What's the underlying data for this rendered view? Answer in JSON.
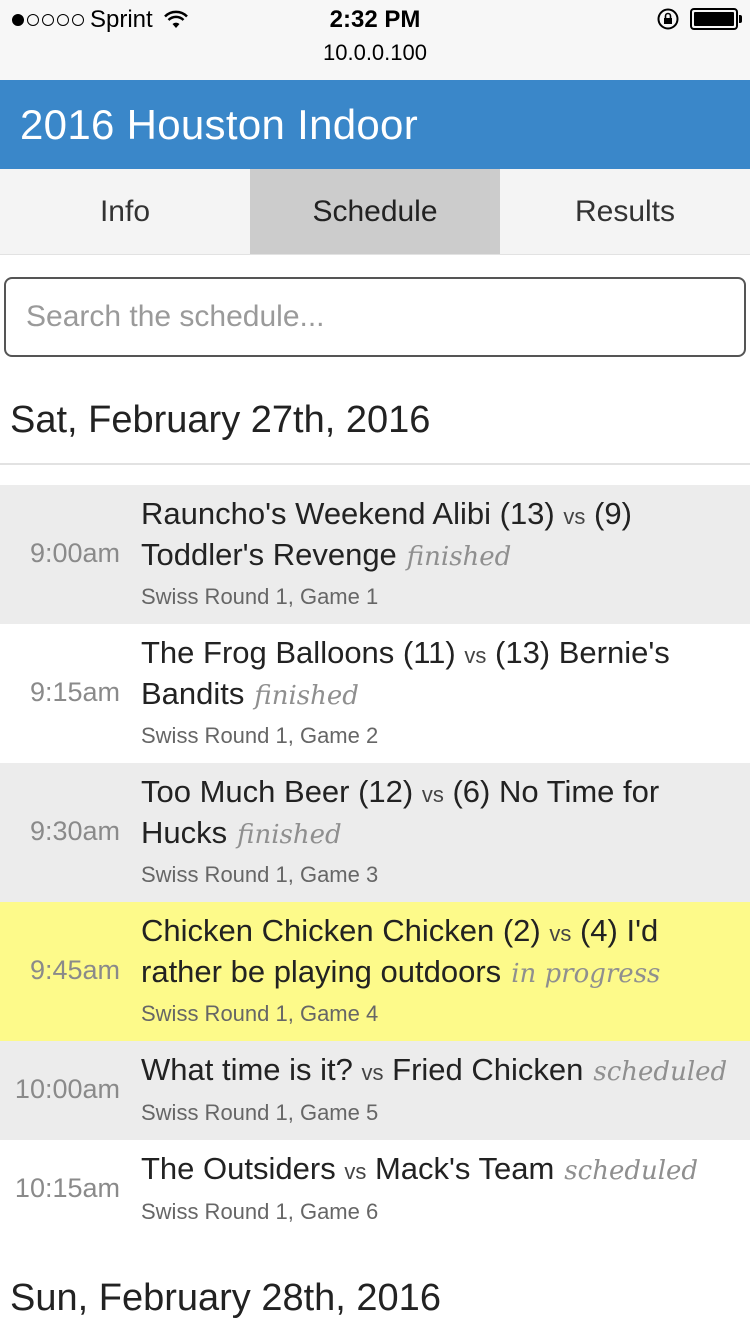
{
  "status_bar": {
    "carrier": "Sprint",
    "time": "2:32 PM",
    "url": "10.0.0.100",
    "signal_bars": 1,
    "battery_level": 1.0
  },
  "app": {
    "title": "2016 Houston Indoor",
    "accent_color": "#3a87c9"
  },
  "tabs": [
    {
      "label": "Info",
      "active": false
    },
    {
      "label": "Schedule",
      "active": true
    },
    {
      "label": "Results",
      "active": false
    }
  ],
  "search": {
    "placeholder": "Search the schedule...",
    "value": ""
  },
  "days": [
    {
      "heading": "Sat, February 27th, 2016",
      "games": [
        {
          "time": "9:00am",
          "team1": "Rauncho's Weekend Alibi (13)",
          "vs": "vs",
          "team2": "(9) Toddler's Revenge",
          "status": "finished",
          "round": "Swiss Round 1, Game 1"
        },
        {
          "time": "9:15am",
          "team1": "The Frog Balloons (11)",
          "vs": "vs",
          "team2": "(13) Bernie's Bandits",
          "status": "finished",
          "round": "Swiss Round 1, Game 2"
        },
        {
          "time": "9:30am",
          "team1": "Too Much Beer (12)",
          "vs": "vs",
          "team2": "(6) No Time for Hucks",
          "status": "finished",
          "round": "Swiss Round 1, Game 3"
        },
        {
          "time": "9:45am",
          "team1": "Chicken Chicken Chicken (2)",
          "vs": "vs",
          "team2": "(4) I'd rather be playing outdoors",
          "status": "in progress",
          "round": "Swiss Round 1, Game 4"
        },
        {
          "time": "10:00am",
          "team1": "What time is it?",
          "vs": "vs",
          "team2": "Fried Chicken",
          "status": "scheduled",
          "round": "Swiss Round 1, Game 5"
        },
        {
          "time": "10:15am",
          "team1": "The Outsiders",
          "vs": "vs",
          "team2": "Mack's Team",
          "status": "scheduled",
          "round": "Swiss Round 1, Game 6"
        }
      ]
    },
    {
      "heading": "Sun, February 28th, 2016"
    }
  ],
  "colors": {
    "highlight_row": "#fdfa8a",
    "shaded_row": "#ececec",
    "active_tab": "#cccccc"
  }
}
